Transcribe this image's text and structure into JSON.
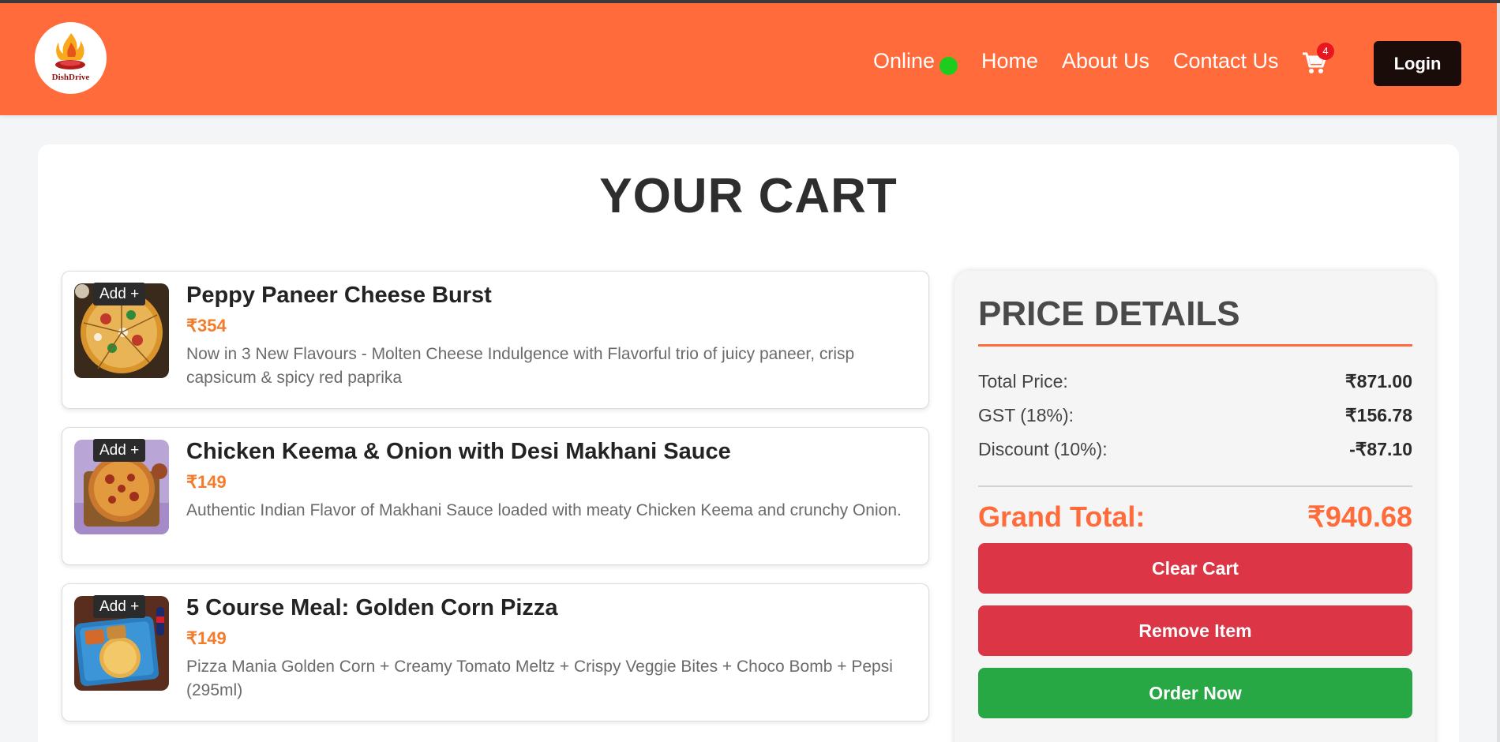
{
  "brand": {
    "logo_text": "DishDrive"
  },
  "nav": {
    "online_label": "Online",
    "home": "Home",
    "about": "About Us",
    "contact": "Contact Us",
    "cart_count": "4",
    "login": "Login"
  },
  "cart": {
    "title": "YOUR CART",
    "add_label": "Add +",
    "items": [
      {
        "name": "Peppy Paneer Cheese Burst",
        "price": "₹354",
        "description": "Now in 3 New Flavours - Molten Cheese Indulgence with Flavorful trio of juicy paneer, crisp capsicum & spicy red paprika"
      },
      {
        "name": "Chicken Keema & Onion with Desi Makhani Sauce",
        "price": "₹149",
        "description": "Authentic Indian Flavor of Makhani Sauce loaded with meaty Chicken Keema and crunchy Onion."
      },
      {
        "name": "5 Course Meal: Golden Corn Pizza",
        "price": "₹149",
        "description": "Pizza Mania Golden Corn + Creamy Tomato Meltz + Crispy Veggie Bites + Choco Bomb + Pepsi (295ml)"
      }
    ]
  },
  "price_details": {
    "title": "PRICE DETAILS",
    "total_label": "Total Price:",
    "total_value": "₹871.00",
    "gst_label": "GST (18%):",
    "gst_value": "₹156.78",
    "discount_label": "Discount (10%):",
    "discount_value": "-₹87.10",
    "grand_label": "Grand Total:",
    "grand_value": "₹940.68",
    "clear_btn": "Clear Cart",
    "remove_btn": "Remove Item",
    "order_btn": "Order Now"
  },
  "colors": {
    "accent": "#ff6b3a",
    "price": "#f47b2a",
    "danger": "#dc3545",
    "success": "#28a745"
  }
}
